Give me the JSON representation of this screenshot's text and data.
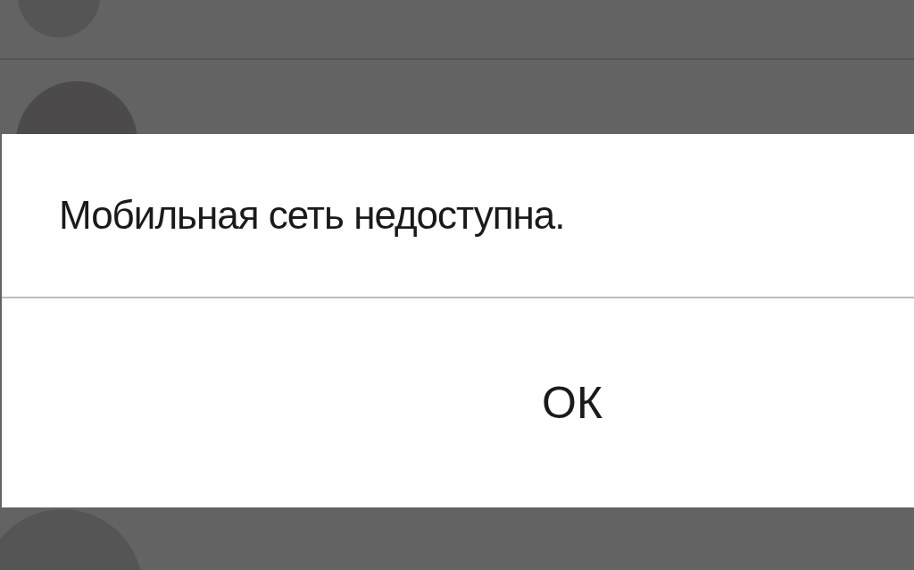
{
  "dialog": {
    "message": "Мобильная сеть недоступна.",
    "buttons": [
      "ОК"
    ]
  }
}
